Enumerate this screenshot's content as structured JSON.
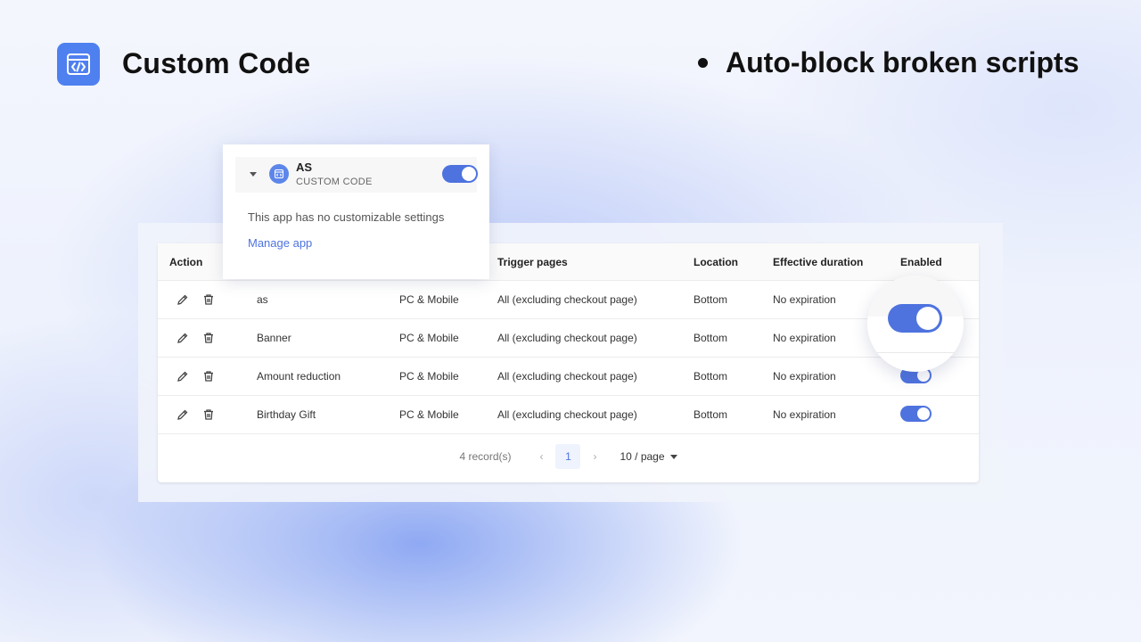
{
  "header": {
    "app_icon": "code-window-icon",
    "title": "Custom Code",
    "feature_bullet": "Auto-block broken scripts"
  },
  "popover": {
    "name": "AS",
    "subtitle": "CUSTOM CODE",
    "enabled": true,
    "message": "This app has no customizable settings",
    "link": "Manage app"
  },
  "table": {
    "columns": [
      "Action",
      "",
      "",
      "Trigger pages",
      "Location",
      "Effective duration",
      "Enabled"
    ],
    "rows": [
      {
        "name": "as",
        "device": "PC & Mobile",
        "trigger": "All (excluding checkout page)",
        "location": "Bottom",
        "duration": "No expiration",
        "enabled": true
      },
      {
        "name": "Banner",
        "device": "PC & Mobile",
        "trigger": "All (excluding checkout page)",
        "location": "Bottom",
        "duration": "No expiration",
        "enabled": true
      },
      {
        "name": "Amount reduction",
        "device": "PC & Mobile",
        "trigger": "All (excluding checkout page)",
        "location": "Bottom",
        "duration": "No expiration",
        "enabled": true
      },
      {
        "name": "Birthday Gift",
        "device": "PC & Mobile",
        "trigger": "All (excluding checkout page)",
        "location": "Bottom",
        "duration": "No expiration",
        "enabled": true
      }
    ]
  },
  "pagination": {
    "records": "4 record(s)",
    "current_page": "1",
    "page_size": "10 / page"
  },
  "colors": {
    "accent": "#4e73df",
    "app_icon_bg": "#4f80f0"
  }
}
